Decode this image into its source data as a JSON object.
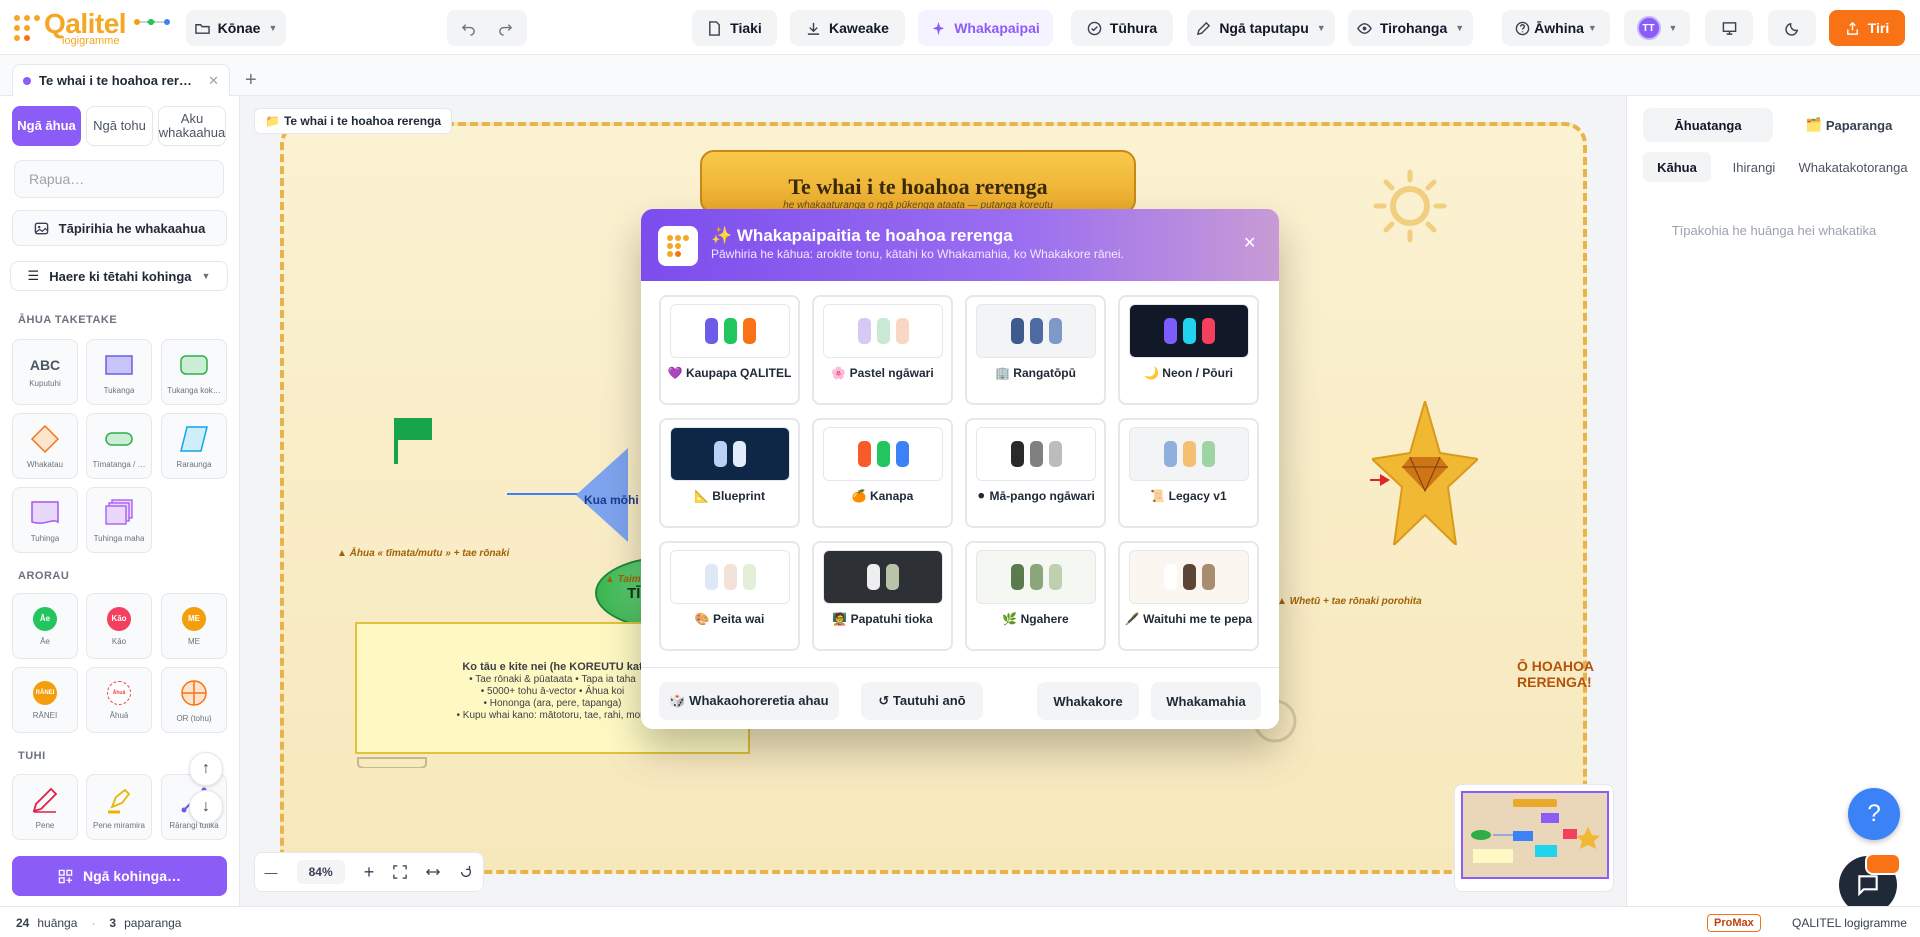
{
  "app": {
    "logo_text": "Qalitel",
    "logo_sub": "logigramme"
  },
  "toolbar": {
    "file_menu": "Kōnae",
    "save": "Tiaki",
    "export": "Kaweake",
    "beautify": "Whakapaipai",
    "verify": "Tūhura",
    "tools_menu": "Ngā taputapu",
    "view_menu": "Tirohanga",
    "help_menu": "Āwhina",
    "avatar_initials": "TT",
    "send": "Tiri"
  },
  "tabs": {
    "doc_tab_label": "Te whai i te hoahoa rer…"
  },
  "sidebar": {
    "segments": [
      "Ngā āhua",
      "Ngā tohu",
      "Aku whakaahua"
    ],
    "search_placeholder": "Rapua…",
    "import_image": "Tāpirihia he whakaahua",
    "goto_section": "Haere ki tētahi kohinga",
    "sections": {
      "basic": "ĀHUA TAKETAKE",
      "arorau": "ARORAU",
      "tuhi": "TUHI"
    },
    "basic_shapes": [
      "Kuputuhi",
      "Tukanga",
      "Tukanga kok…",
      "Whakatau",
      "Tīmatanga / …",
      "Raraunga",
      "Tuhinga",
      "Tuhinga maha"
    ],
    "logic_shapes": [
      {
        "badge": "Āe",
        "label": "Āe"
      },
      {
        "badge": "Kāo",
        "label": "Kāo"
      },
      {
        "badge": "ME",
        "label": "ME"
      },
      {
        "badge": "RĀNEI",
        "label": "RĀNEI"
      },
      {
        "badge": "Āhuā",
        "label": "Āhuā"
      },
      {
        "badge": "",
        "label": "OR (tohu)"
      }
    ],
    "draw_tools": [
      "Pene",
      "Pene miramira",
      "Rārangi tūtika"
    ],
    "more_collections": "Ngā kohinga…"
  },
  "canvas": {
    "breadcrumb": "Te whai i te hoahoa rerenga",
    "banner_title": "Te whai i te hoahoa rerenga",
    "banner_subtitle": "he whakaaturanga o ngā pūkenga ataata — putanga koreutu",
    "start_label": "TĪMATANGA",
    "start_note": "▲ Āhua « tīmata/mutu » + tae rōnaki",
    "diamond_label": "Kua mōhi",
    "diamond_note": "▲ Taim",
    "finish_label": "Ō HOAHOA RERENGA!",
    "finish_note": "▲ Whetū + tae rōnaki porohita",
    "note_title": "Ko tāu e kite nei (he KOREUTU kat",
    "note_lines": [
      "• Tae rōnaki & pūataata • Tapa ia taha",
      "• 5000+ tohu ā-vector • Āhua koi",
      "• Hononga (ara, pere, tapanga)",
      "• Kupu whai kano: mātotoru, tae, rahi, mom"
    ],
    "zoom": "84%"
  },
  "right_panel": {
    "tabs": [
      "Āhuatanga",
      "Paparanga"
    ],
    "subtabs": [
      "Kāhua",
      "Ihirangi",
      "Whakatakotoranga"
    ],
    "hint": "Tīpakohia he huānga hei whakatika"
  },
  "status": {
    "count_elements": "24",
    "elements_label": "huānga",
    "count_layers": "3",
    "layers_label": "paparanga",
    "badge": "ProMax",
    "brand": "QALITEL logigramme"
  },
  "modal": {
    "title": "✨ Whakapaipaitia te hoahoa rerenga",
    "subtitle": "Pāwhiria he kāhua: arokite tonu, kātahi ko Whakamahia, ko Whakakore rānei.",
    "themes": [
      {
        "label": "💜 Kaupapa QALITEL",
        "bg": "#ffffff",
        "colors": [
          "#6d5ce7",
          "#22c55e",
          "#f97316"
        ]
      },
      {
        "label": "🌸 Pastel ngāwari",
        "bg": "#ffffff",
        "colors": [
          "#d8c8f5",
          "#c9e8d5",
          "#f8d8c4"
        ]
      },
      {
        "label": "🏢 Rangatōpū",
        "bg": "#f3f4f6",
        "colors": [
          "#3f5a8c",
          "#4d6aa3",
          "#7e98c8"
        ]
      },
      {
        "label": "🌙 Neon / Pōuri",
        "bg": "#111827",
        "colors": [
          "#7c5cfc",
          "#22d3ee",
          "#f43f5e"
        ]
      },
      {
        "label": "📐 Blueprint",
        "bg": "#0f2747",
        "colors": [
          "#b8d1f5",
          "#e3ecfa"
        ]
      },
      {
        "label": "🍊 Kanapa",
        "bg": "#ffffff",
        "colors": [
          "#f85a28",
          "#22c55e",
          "#3b82f6"
        ]
      },
      {
        "label": "⚫ Mā-pango ngāwari",
        "bg": "#ffffff",
        "colors": [
          "#2a2a2a",
          "#808080",
          "#bcbcbc"
        ]
      },
      {
        "label": "📜 Legacy v1",
        "bg": "#f3f4f6",
        "colors": [
          "#8fb0dc",
          "#f2c070",
          "#9ed3a4"
        ]
      },
      {
        "label": "🎨 Peita wai",
        "bg": "#ffffff",
        "colors": [
          "#dfe8f5",
          "#f3e2d8",
          "#e3efd9"
        ]
      },
      {
        "label": "🧑‍🏫 Papatuhi tioka",
        "bg": "#2d3035",
        "colors": [
          "#eeeeee",
          "#b8c4a8"
        ]
      },
      {
        "label": "🌿 Ngahere",
        "bg": "#f5f7f3",
        "colors": [
          "#5b7a50",
          "#8aa67a",
          "#bed0b0"
        ]
      },
      {
        "label": "🖋️ Waituhi me te pepa",
        "bg": "#fbf7f0",
        "colors": [
          "#ffffff",
          "#5b4636",
          "#a88c70"
        ]
      }
    ],
    "random": "🎲 Whakaohoreretia ahau",
    "reset": "↺ Tautuhi anō",
    "cancel": "Whakakore",
    "apply": "Whakamahia"
  }
}
